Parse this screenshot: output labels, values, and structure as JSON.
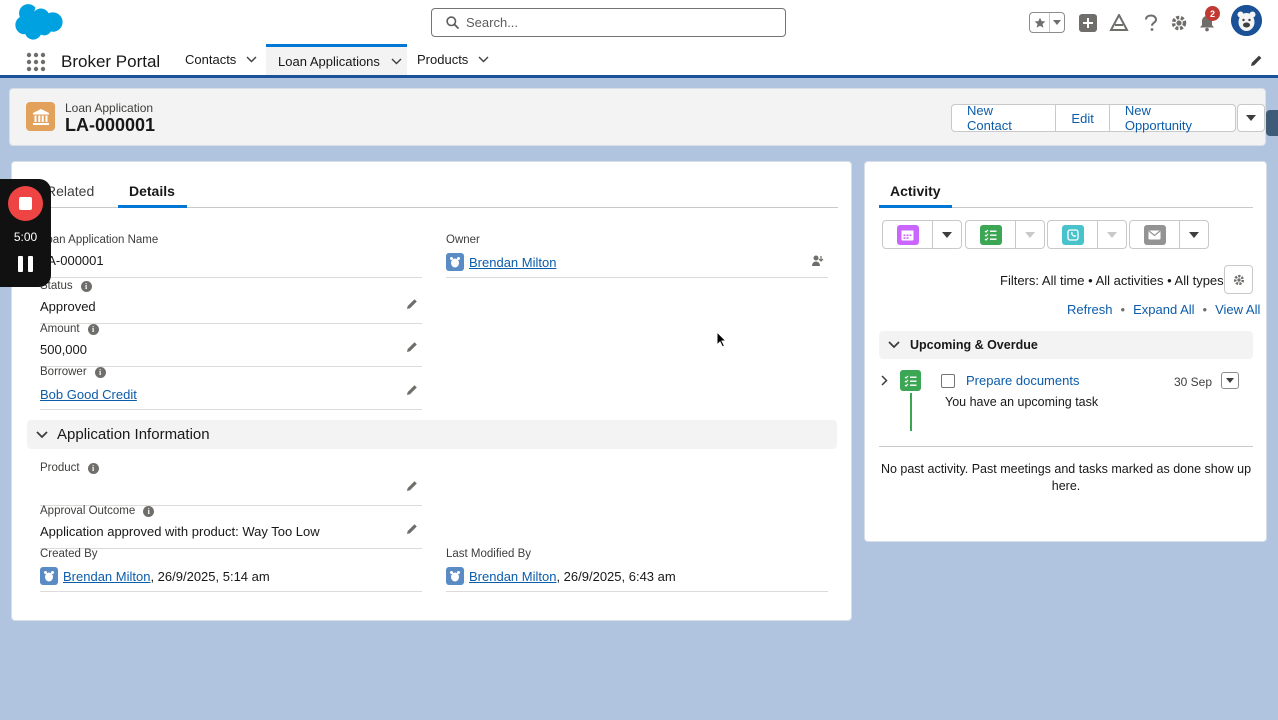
{
  "header": {
    "search_placeholder": "Search...",
    "notification_count": "2"
  },
  "nav": {
    "app_name": "Broker Portal",
    "items": [
      {
        "label": "Contacts"
      },
      {
        "label": "Loan Applications",
        "active": true
      },
      {
        "label": "Products"
      }
    ]
  },
  "record": {
    "type_label": "Loan Application",
    "name": "LA-000001",
    "actions": [
      "New Contact",
      "Edit",
      "New Opportunity"
    ]
  },
  "tabs": {
    "related": "Related",
    "details": "Details"
  },
  "recorder": {
    "time": "5:00"
  },
  "fields": {
    "loan_application_name": {
      "label": "Loan Application Name",
      "value": "LA-000001"
    },
    "owner": {
      "label": "Owner",
      "value": "Brendan Milton"
    },
    "status": {
      "label": "Status",
      "value": "Approved"
    },
    "amount": {
      "label": "Amount",
      "value": "500,000"
    },
    "borrower": {
      "label": "Borrower",
      "value": "Bob Good Credit"
    },
    "product": {
      "label": "Product",
      "value": ""
    },
    "approval_outcome": {
      "label": "Approval Outcome",
      "value": "Application approved with product: Way Too Low"
    },
    "created_by": {
      "label": "Created By",
      "user": "Brendan Milton",
      "date": ", 26/9/2025, 5:14 am"
    },
    "last_modified_by": {
      "label": "Last Modified By",
      "user": "Brendan Milton",
      "date": ", 26/9/2025, 6:43 am"
    }
  },
  "sections": {
    "application_information": "Application Information"
  },
  "activity": {
    "tab": "Activity",
    "filters": "Filters: All time • All activities • All types",
    "links": {
      "refresh": "Refresh",
      "expand_all": "Expand All",
      "view_all": "View All",
      "separator": "•"
    },
    "upcoming_title": "Upcoming & Overdue",
    "task": {
      "title": "Prepare documents",
      "description": "You have an upcoming task",
      "date": "30 Sep"
    },
    "no_past": "No past activity. Past meetings and tasks marked as done show up here.",
    "colors": {
      "event": "#cb65ff",
      "task": "#3ba755",
      "call": "#48c3cc",
      "email": "#939393"
    }
  },
  "colors": {
    "brand": "#0176d3",
    "link": "#0b5cab",
    "record_icon": "#e2a25c",
    "nav_bar": "#1b5297"
  }
}
